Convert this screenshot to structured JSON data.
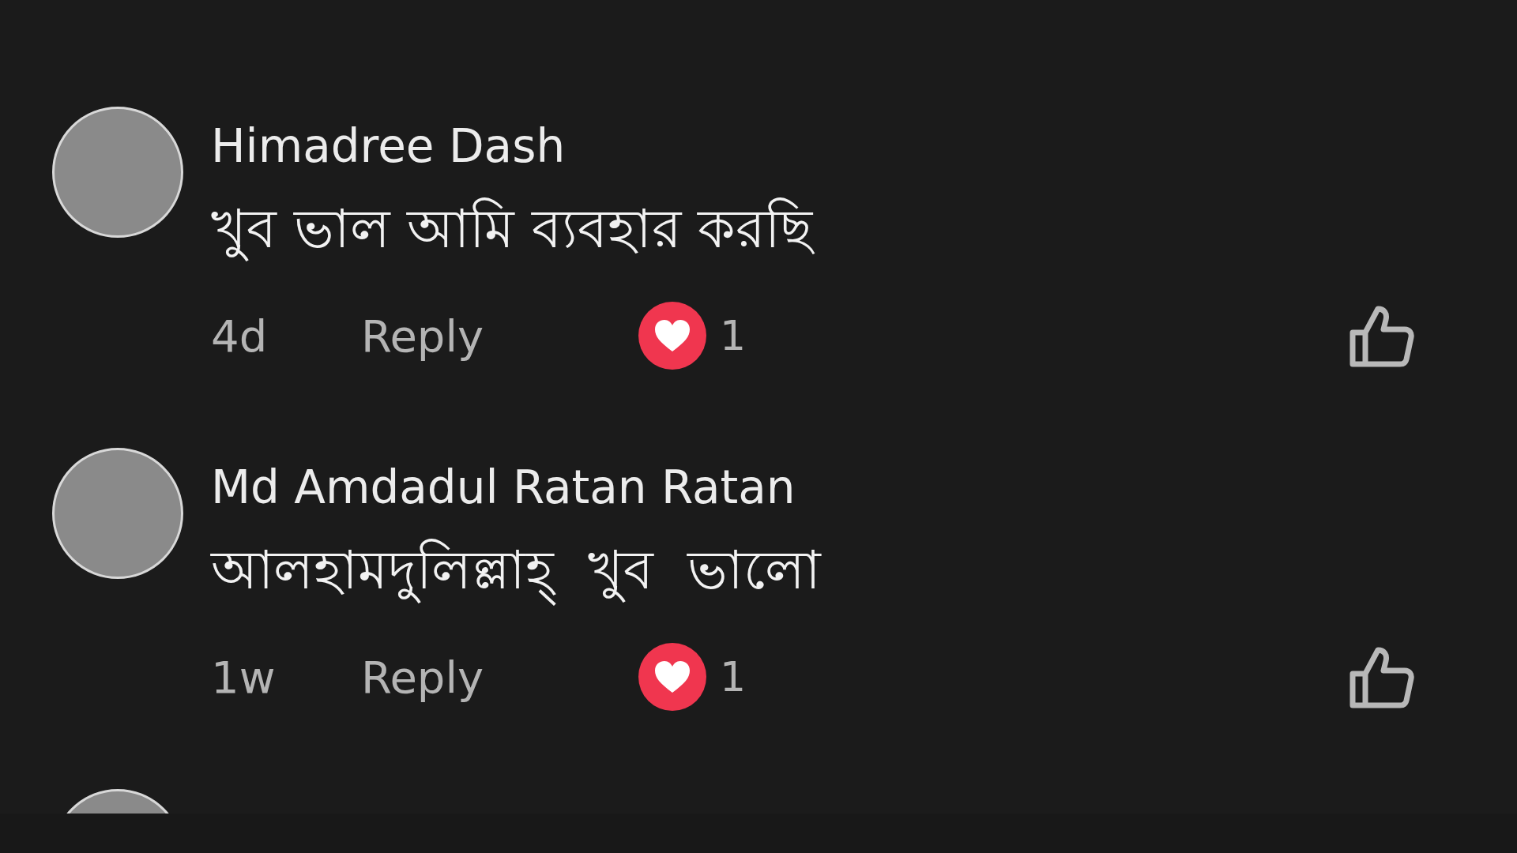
{
  "comments": [
    {
      "author": "Himadree Dash",
      "text": "খুব ভাল আমি ব্যবহার করছি",
      "time": "4d",
      "reply": "Reply",
      "reaction_count": "1"
    },
    {
      "author": "Md Amdadul Ratan Ratan",
      "text": "আলহামদুলিল্লাহ্  খুব  ভালো",
      "time": "1w",
      "reply": "Reply",
      "reaction_count": "1"
    }
  ],
  "next_comment_cut_off": true
}
